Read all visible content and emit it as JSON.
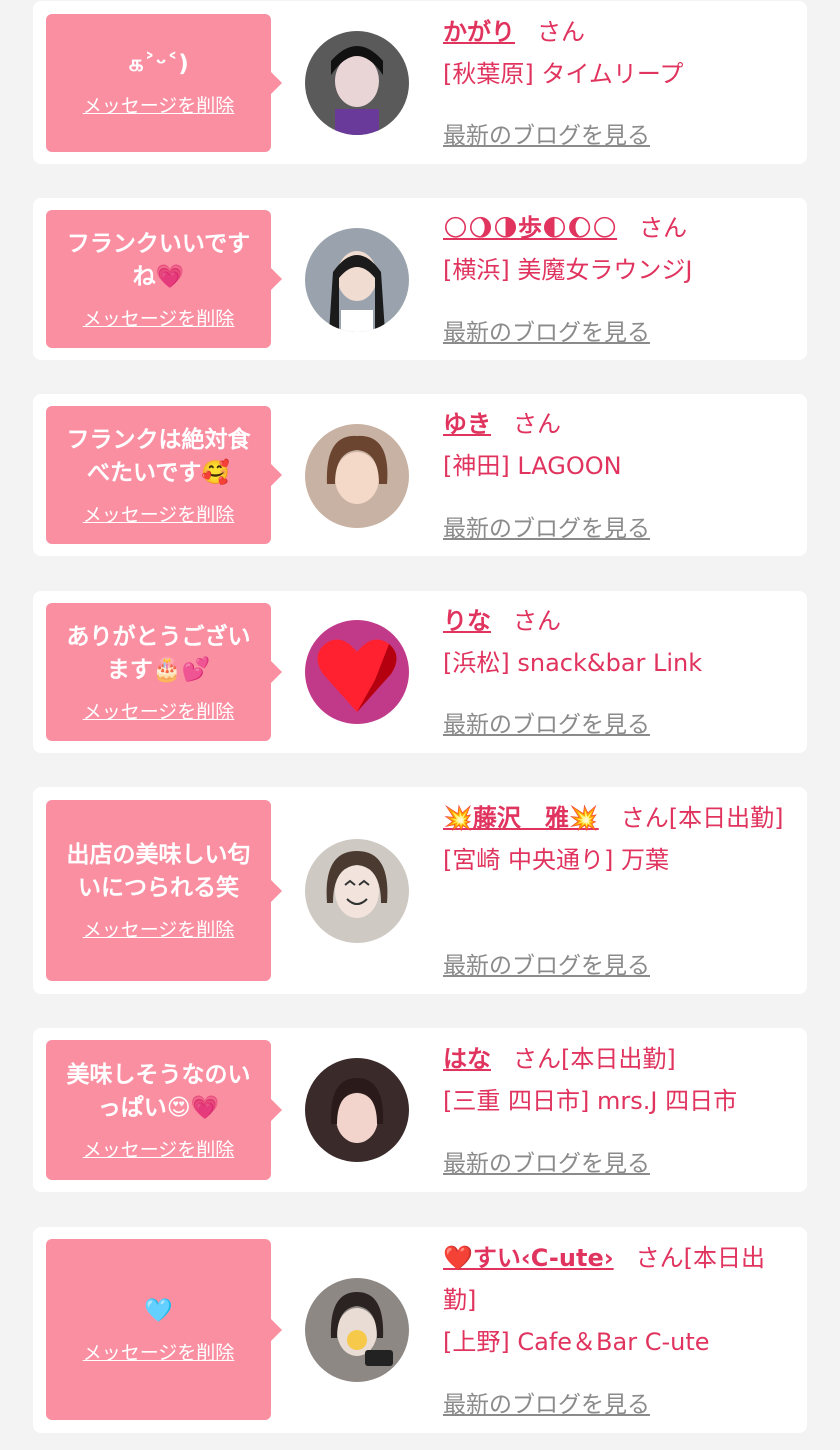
{
  "suffix_san": "さん",
  "entries": [
    {
      "message": "௧˃ᵕ˂)",
      "delete_label": "メッセージを削除",
      "name": "かがり",
      "status": "",
      "shop": "[秋葉原] タイムリープ",
      "blog_label": "最新のブログを見る",
      "avatar_colors": [
        "#5a5a5a",
        "#e9d4d6",
        "#6a3a9a"
      ]
    },
    {
      "message": "フランクいいですね💗",
      "delete_label": "メッセージを削除",
      "name": "🌕🌖🌗歩🌓🌔🌕",
      "status": "",
      "shop": "[横浜] 美魔女ラウンジJ",
      "blog_label": "最新のブログを見る",
      "avatar_colors": [
        "#9aa3ad",
        "#f1dcd2",
        "#1b1b1b"
      ]
    },
    {
      "message": "フランクは絶対食べたいです🥰",
      "delete_label": "メッセージを削除",
      "name": "ゆき",
      "status": "",
      "shop": "[神田] LAGOON",
      "blog_label": "最新のブログを見る",
      "avatar_colors": [
        "#c8b2a3",
        "#f4d8c8",
        "#6b4530"
      ]
    },
    {
      "message": "ありがとうございます🎂💕",
      "delete_label": "メッセージを削除",
      "name": "りな",
      "status": "",
      "shop": "[浜松] snack&bar Link",
      "blog_label": "最新のブログを見る",
      "avatar_colors": [
        "#c13a8a",
        "#ff2030",
        "#b50010"
      ]
    },
    {
      "message": "出店の美味しい匂いにつられる笑",
      "delete_label": "メッセージを削除",
      "name": "💥藤沢　雅💥",
      "status": "[本日出勤]",
      "shop": "[宮崎 中央通り] 万葉",
      "blog_label": "最新のブログを見る",
      "avatar_colors": [
        "#cfc9c3",
        "#f2e4dc",
        "#4a3a30"
      ]
    },
    {
      "message": "美味しそうなのいっぱい😍💗",
      "delete_label": "メッセージを削除",
      "name": "はな",
      "status": "[本日出勤]",
      "shop": "[三重 四日市] mrs.J 四日市",
      "blog_label": "最新のブログを見る",
      "avatar_colors": [
        "#3a2a2a",
        "#f2d4cc",
        "#2a1a1a"
      ]
    },
    {
      "message": "🩵",
      "delete_label": "メッセージを削除",
      "name": "❤️すい‹C-ute›",
      "status": "[本日出勤]",
      "shop": "[上野] Cafe＆Bar C-ute",
      "blog_label": "最新のブログを見る",
      "avatar_colors": [
        "#8e8884",
        "#e9dcd4",
        "#2a2322"
      ]
    }
  ]
}
